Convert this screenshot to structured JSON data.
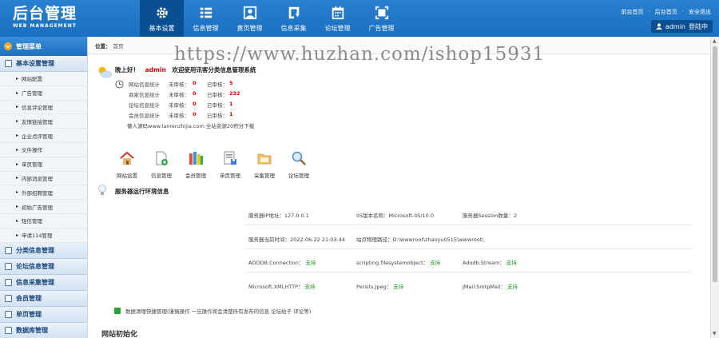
{
  "logo": {
    "title": "后台管理",
    "subtitle": "WEB MANAGEMENT"
  },
  "nav": [
    {
      "label": "基本设置",
      "icon": "gear-icon",
      "active": true
    },
    {
      "label": "信息管理",
      "icon": "list-icon"
    },
    {
      "label": "黄页管理",
      "icon": "portrait-icon"
    },
    {
      "label": "信息采集",
      "icon": "download-icon"
    },
    {
      "label": "论坛管理",
      "icon": "calendar-icon"
    },
    {
      "label": "广告管理",
      "icon": "fullscreen-icon"
    }
  ],
  "toplinks": [
    "前台首页",
    "后台首页",
    "安全退出"
  ],
  "user": {
    "name": "admin",
    "status": "登陆中"
  },
  "sidebar": {
    "header": "管理菜单",
    "category_main": "基本设置管理",
    "items": [
      "网站配置",
      "广告管理",
      "信息评论管理",
      "友情链接管理",
      "企业点评管理",
      "文件操作",
      "单页管理",
      "内部消息管理",
      "外部招聘管理",
      "初始广告管理",
      "短信管理",
      "申请114管理"
    ],
    "categories": [
      "分类信息管理",
      "论坛信息管理",
      "信息采集管理",
      "会员管理",
      "单页管理",
      "数据库管理"
    ]
  },
  "breadcrumb": {
    "label": "位置：",
    "path": "首页"
  },
  "greeting": {
    "hello": "晚上好！",
    "user": "admin",
    "welcome": "欢迎使用讯客分类信息管理系统"
  },
  "stats": [
    {
      "label": "网站信息统计",
      "k1": "未审核：",
      "v1": "0",
      "k2": "已审核：",
      "v2": "5"
    },
    {
      "label": "商家信息统计",
      "k1": "未审核：",
      "v1": "0",
      "k2": "已审核：",
      "v2": "232"
    },
    {
      "label": "论坛信息统计",
      "k1": "未审核：",
      "v1": "0",
      "k2": "已审核：",
      "v2": "1"
    },
    {
      "label": "会员信息统计",
      "k1": "未审核：",
      "v1": "0",
      "k2": "已审核：",
      "v2": "1"
    }
  ],
  "credit": "懒人源码www.lanrenzhijia.com 全站资源20积分下载",
  "quick": [
    {
      "label": "网站设置",
      "icon": "home-icon"
    },
    {
      "label": "信息管理",
      "icon": "document-add-icon"
    },
    {
      "label": "会员管理",
      "icon": "books-icon"
    },
    {
      "label": "单页管理",
      "icon": "page-save-icon"
    },
    {
      "label": "采集管理",
      "icon": "folder-icon"
    },
    {
      "label": "论坛管理",
      "icon": "magnifier-icon"
    }
  ],
  "server": {
    "title": "服务器运行环境信息",
    "rows": [
      [
        {
          "k": "服务器IP地址：",
          "v": "127.0.0.1"
        },
        {
          "k": "IIS版本名称：",
          "v": "Microsoft-IIS/10.0"
        },
        {
          "k": "服务器Session数量：",
          "v": "2"
        }
      ],
      [
        {
          "k": "服务器当前时间：",
          "v": "2022-06-22 21:03:44"
        },
        {
          "k": "站点物理路径：",
          "v": "D:\\wwwroot\\zhaoyu0515\\wwwroot\\"
        }
      ],
      [
        {
          "k": "ADODB.Connection：",
          "ok": "支持"
        },
        {
          "k": "scripting.filesystemobject：",
          "ok": "支持"
        },
        {
          "k": "Adodb.Stream：",
          "ok": "支持"
        }
      ],
      [
        {
          "k": "Microsoft.XMLHTTP：",
          "ok": "支持"
        },
        {
          "k": "Persits.Jpeg：",
          "ok": "支持"
        },
        {
          "k": "JMail.SmtpMail：",
          "ok": "支持"
        }
      ]
    ]
  },
  "clean": "数据清理快捷管理(谨慎操作 一旦操作将会清楚所有发布的信息 论坛帖子 评论等)",
  "init": "网站初始化",
  "watermark": "https://www.huzhan.com/ishop15931"
}
